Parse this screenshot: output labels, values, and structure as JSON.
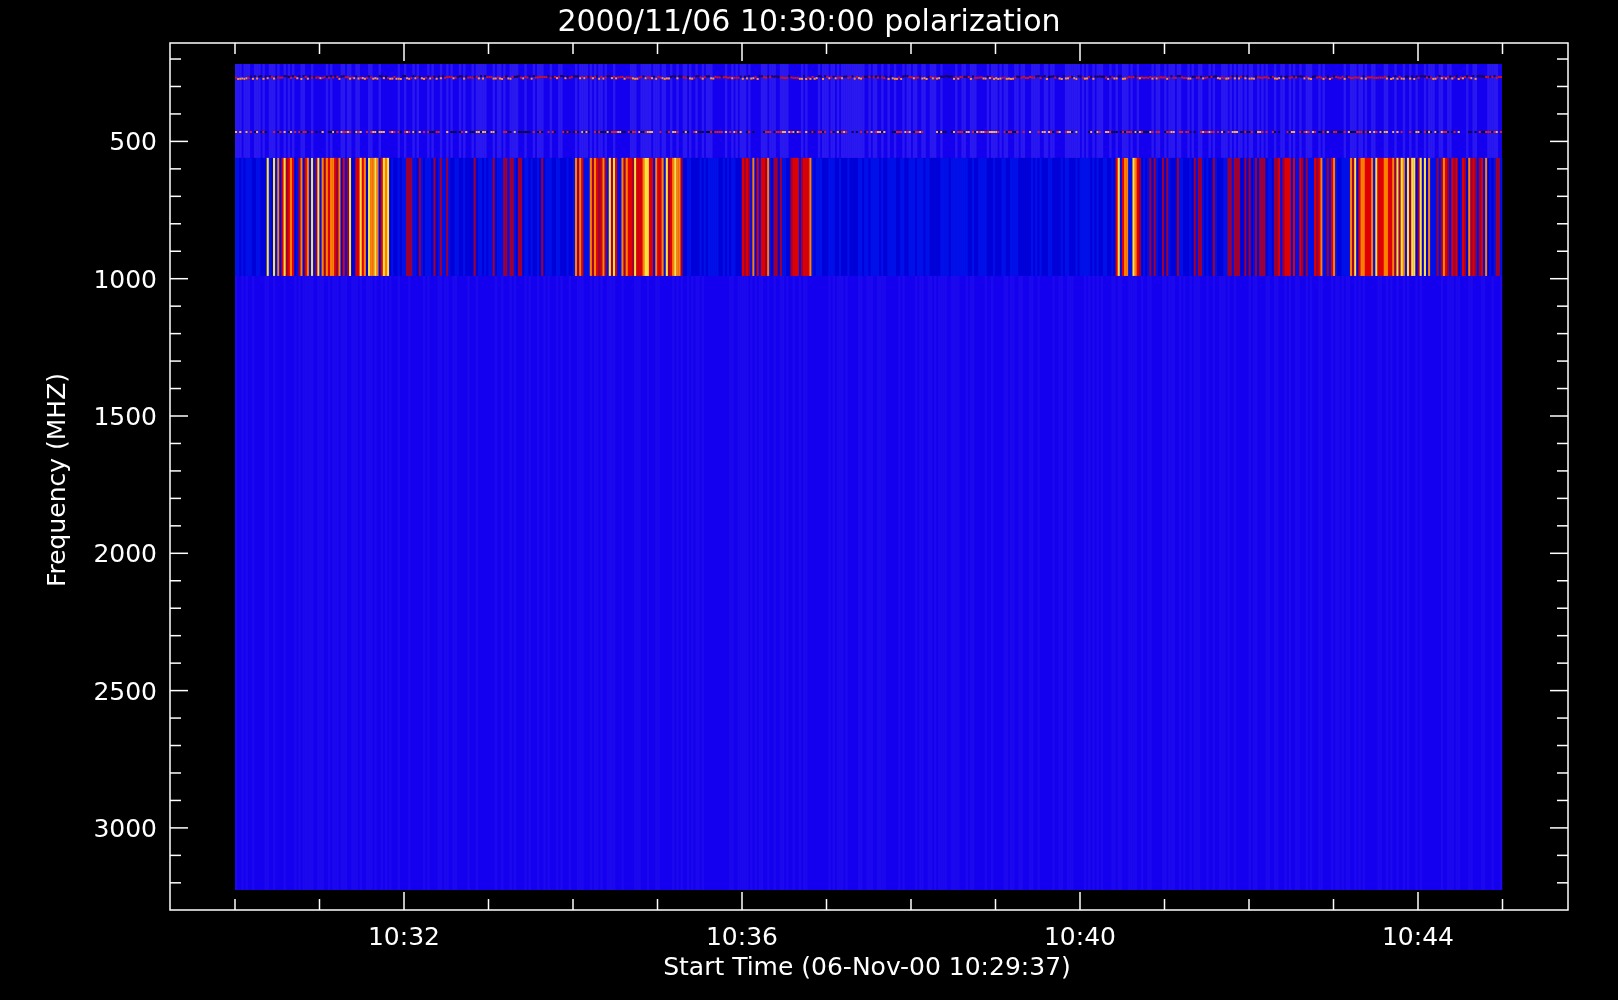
{
  "title": "2000/11/06 10:30:00 polarization",
  "plot": {
    "y_label": "Frequency (MHZ)",
    "y_ticks": [
      "500",
      "1000",
      "1500",
      "2000",
      "2500",
      "3000"
    ],
    "x_ticks": [
      "10:32",
      "10:36",
      "10:40",
      "10:44"
    ],
    "x_label": "Start Time (06-Nov-00 10:29:37)"
  }
}
